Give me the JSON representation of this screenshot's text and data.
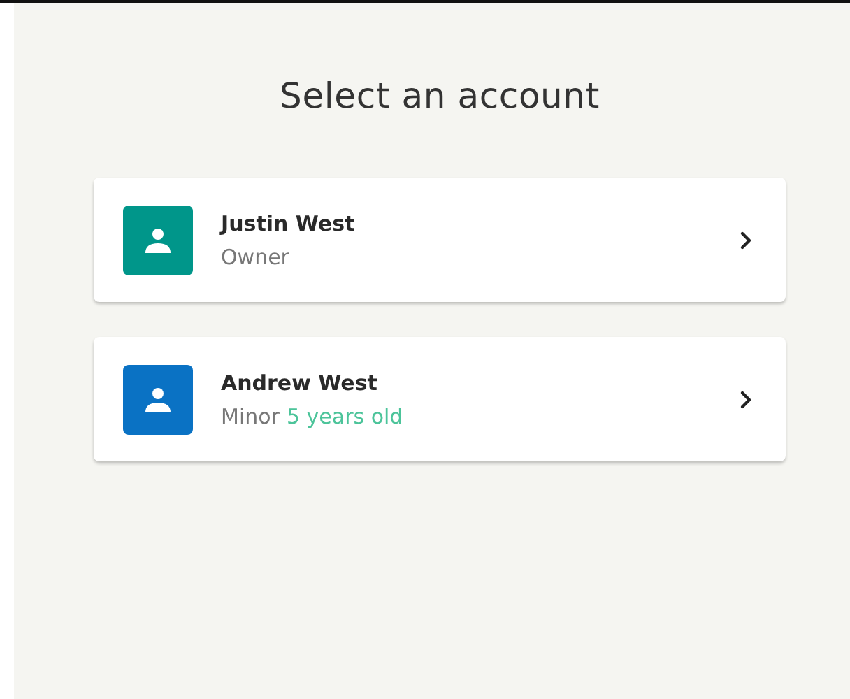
{
  "title": "Select an account",
  "accounts": [
    {
      "name": "Justin West",
      "role": "Owner",
      "color": "#00968a"
    },
    {
      "name": "Andrew West",
      "role": "Minor",
      "age": "5 years old",
      "color": "#0a72c4"
    }
  ]
}
